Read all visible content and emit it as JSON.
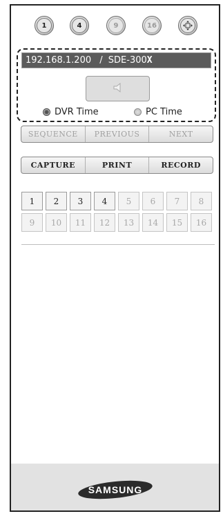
{
  "layout_buttons": [
    {
      "label": "1",
      "dim": false
    },
    {
      "label": "4",
      "dim": false
    },
    {
      "label": "9",
      "dim": true
    },
    {
      "label": "16",
      "dim": true
    }
  ],
  "connection": {
    "ip": "192.168.1.200",
    "separator": "/",
    "model_prefix": "SDE-300",
    "model_suffix": "X"
  },
  "time_mode": {
    "dvr_label": "DVR Time",
    "pc_label": "PC Time",
    "selected": "DVR Time"
  },
  "playback_bar": [
    "SEQUENCE",
    "PREVIOUS",
    "NEXT"
  ],
  "action_bar": [
    "CAPTURE",
    "PRINT",
    "RECORD"
  ],
  "channels": [
    {
      "label": "1",
      "active": true
    },
    {
      "label": "2",
      "active": true
    },
    {
      "label": "3",
      "active": true
    },
    {
      "label": "4",
      "active": true
    },
    {
      "label": "5",
      "active": false
    },
    {
      "label": "6",
      "active": false
    },
    {
      "label": "7",
      "active": false
    },
    {
      "label": "8",
      "active": false
    },
    {
      "label": "9",
      "active": false
    },
    {
      "label": "10",
      "active": false
    },
    {
      "label": "11",
      "active": false
    },
    {
      "label": "12",
      "active": false
    },
    {
      "label": "13",
      "active": false
    },
    {
      "label": "14",
      "active": false
    },
    {
      "label": "15",
      "active": false
    },
    {
      "label": "16",
      "active": false
    }
  ],
  "brand": "SAMSUNG"
}
